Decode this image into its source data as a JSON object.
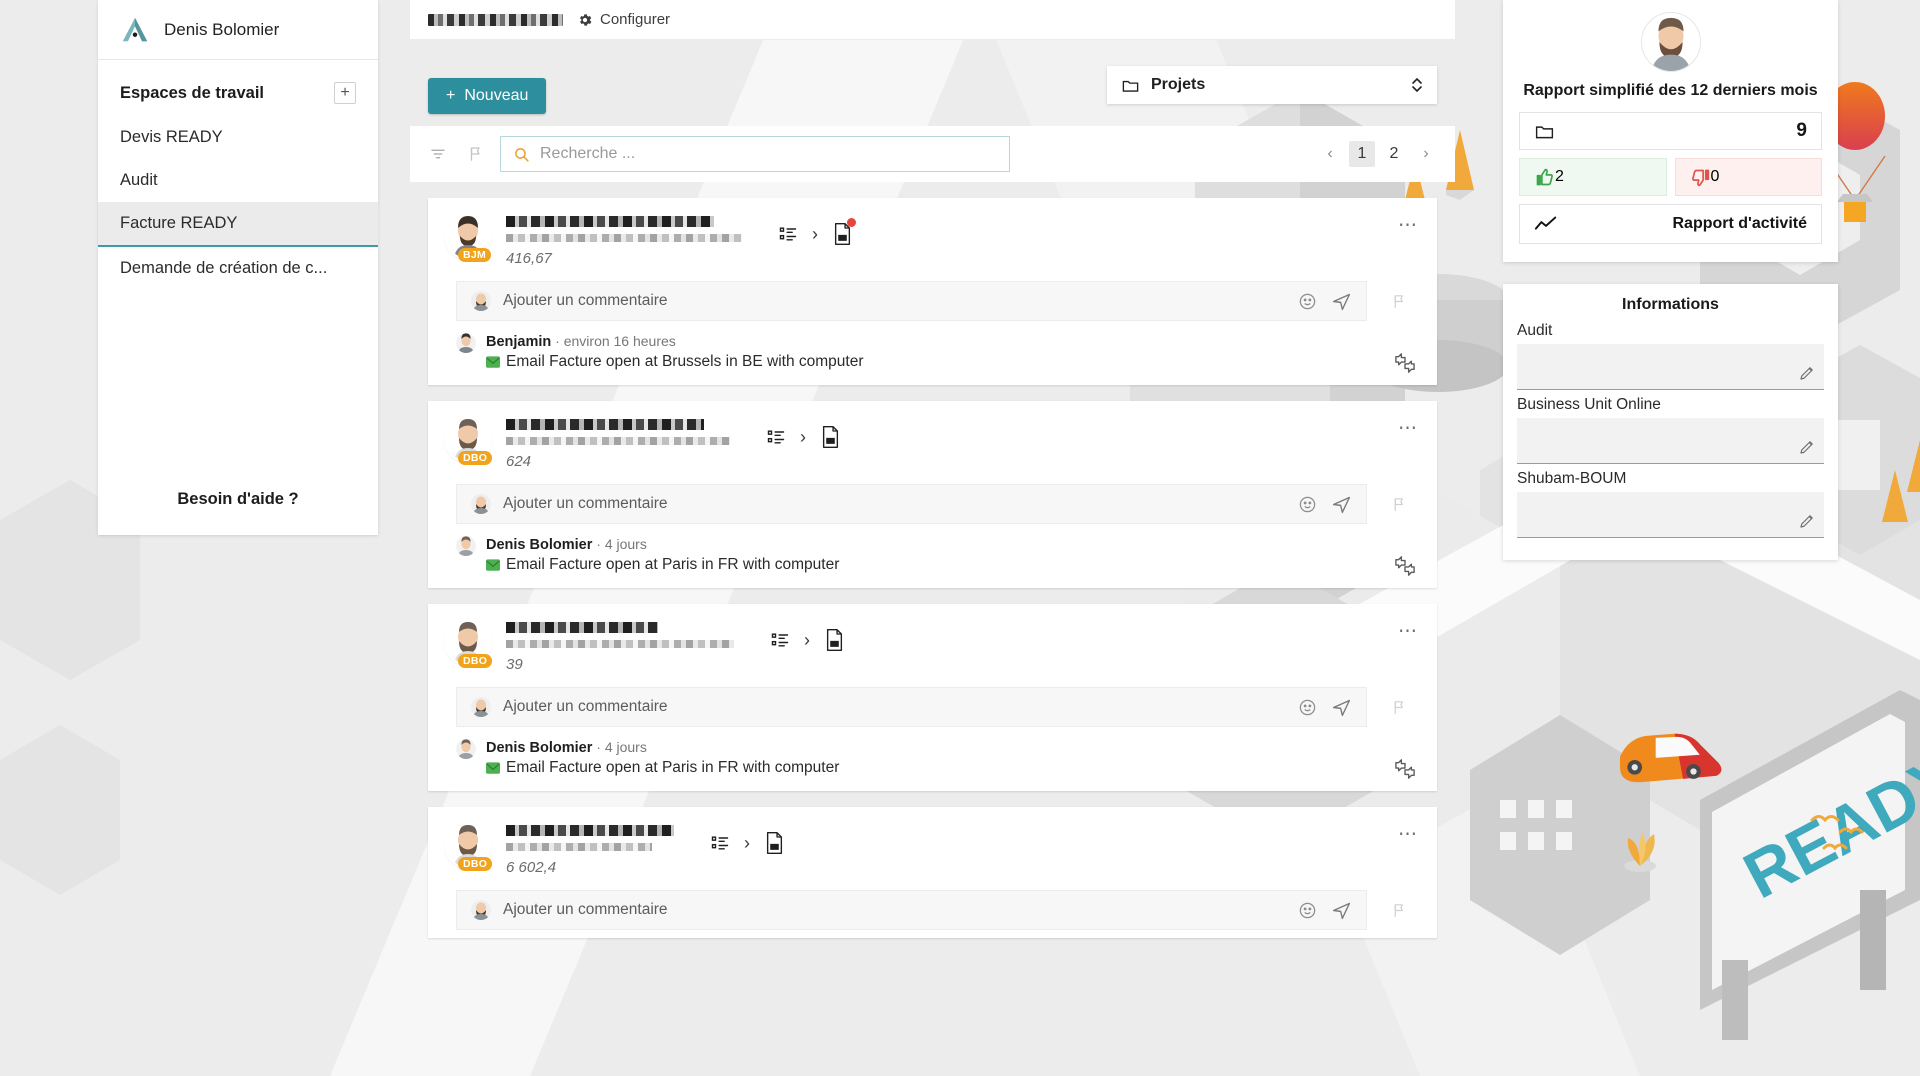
{
  "sidebar": {
    "user_name": "Denis Bolomier",
    "logo_icon": "brand-logo-icon",
    "workspaces_label": "Espaces de travail",
    "add_label": "+",
    "items": [
      {
        "label": "Devis READY",
        "active": false
      },
      {
        "label": "Audit",
        "active": false
      },
      {
        "label": "Facture READY",
        "active": true
      },
      {
        "label": "Demande de création de c...",
        "active": false
      }
    ],
    "help_label": "Besoin d'aide ?"
  },
  "topbar": {
    "redacted_title": "",
    "configure_label": "Configurer",
    "gear_icon": "gear-icon"
  },
  "toolbar": {
    "new_label": "Nouveau",
    "new_plus": "+",
    "project_select_label": "Projets",
    "folder_icon": "folder-icon",
    "chevron_updown_icon": "chevron-updown-icon"
  },
  "search": {
    "placeholder": "Recherche ...",
    "value": "",
    "search_icon": "search-icon",
    "filter_icon": "filter-icon",
    "flag_icon": "flag-icon"
  },
  "pagination": {
    "prev": "‹",
    "next": "›",
    "pages": [
      "1",
      "2"
    ],
    "current": "1"
  },
  "cards": [
    {
      "initials": "BJM",
      "amount": "416,67",
      "has_notification": true,
      "list_icon": "list-icon",
      "chevron_icon": "chevron-right-icon",
      "pdf_icon": "pdf-file-icon",
      "menu_icon": "more-options-icon",
      "comment_placeholder": "Ajouter un commentaire",
      "emoji_icon": "emoji-icon",
      "send_icon": "send-icon",
      "flag_icon": "flag-icon",
      "activity": {
        "author": "Benjamin",
        "separator": "·",
        "time": "environ 16 heures",
        "badge_icon": "green-envelope-icon",
        "text": "Email Facture open at Brussels in BE with computer",
        "react_icon": "thumbs-react-icon"
      }
    },
    {
      "initials": "DBO",
      "amount": "624",
      "has_notification": false,
      "list_icon": "list-icon",
      "chevron_icon": "chevron-right-icon",
      "pdf_icon": "pdf-file-icon",
      "menu_icon": "more-options-icon",
      "comment_placeholder": "Ajouter un commentaire",
      "emoji_icon": "emoji-icon",
      "send_icon": "send-icon",
      "flag_icon": "flag-icon",
      "activity": {
        "author": "Denis Bolomier",
        "separator": "·",
        "time": "4 jours",
        "badge_icon": "green-envelope-icon",
        "text": "Email Facture open at Paris in FR with computer",
        "react_icon": "thumbs-react-icon"
      }
    },
    {
      "initials": "DBO",
      "amount": "39",
      "has_notification": false,
      "list_icon": "list-icon",
      "chevron_icon": "chevron-right-icon",
      "pdf_icon": "pdf-file-icon",
      "menu_icon": "more-options-icon",
      "comment_placeholder": "Ajouter un commentaire",
      "emoji_icon": "emoji-icon",
      "send_icon": "send-icon",
      "flag_icon": "flag-icon",
      "activity": {
        "author": "Denis Bolomier",
        "separator": "·",
        "time": "4 jours",
        "badge_icon": "green-envelope-icon",
        "text": "Email Facture open at Paris in FR with computer",
        "react_icon": "thumbs-react-icon"
      }
    },
    {
      "initials": "DBO",
      "amount": "6 602,4",
      "has_notification": false,
      "list_icon": "list-icon",
      "chevron_icon": "chevron-right-icon",
      "pdf_icon": "pdf-file-icon",
      "menu_icon": "more-options-icon",
      "comment_placeholder": "Ajouter un commentaire",
      "emoji_icon": "emoji-icon",
      "send_icon": "send-icon",
      "flag_icon": "flag-icon",
      "activity": null
    }
  ],
  "report": {
    "title": "Rapport simplifié des 12 derniers mois",
    "avatar_icon": "user-avatar-icon",
    "folder_icon": "folder-icon",
    "folder_count": "9",
    "thumbup_icon": "thumbs-up-icon",
    "thumbup_count": "2",
    "thumbdown_icon": "thumbs-down-icon",
    "thumbdown_count": "0",
    "activity_icon": "trend-line-icon",
    "activity_label": "Rapport d'activité"
  },
  "informations": {
    "title": "Informations",
    "fields": [
      {
        "label": "Audit",
        "value": "",
        "edit_icon": "pencil-icon"
      },
      {
        "label": "Business Unit Online",
        "value": "",
        "edit_icon": "pencil-icon"
      },
      {
        "label": "Shubam-BOUM",
        "value": "",
        "edit_icon": "pencil-icon"
      }
    ]
  },
  "illustration": {
    "billboard_text": "READY",
    "alt": "isometric city illustration"
  },
  "colors": {
    "accent_teal": "#2d8f9e",
    "badge_orange": "#f0a31b",
    "notify_red": "#e8453c",
    "positive_green": "#3aa64a",
    "negative_red": "#e2534c",
    "billboard_teal": "#3fa9bd"
  }
}
